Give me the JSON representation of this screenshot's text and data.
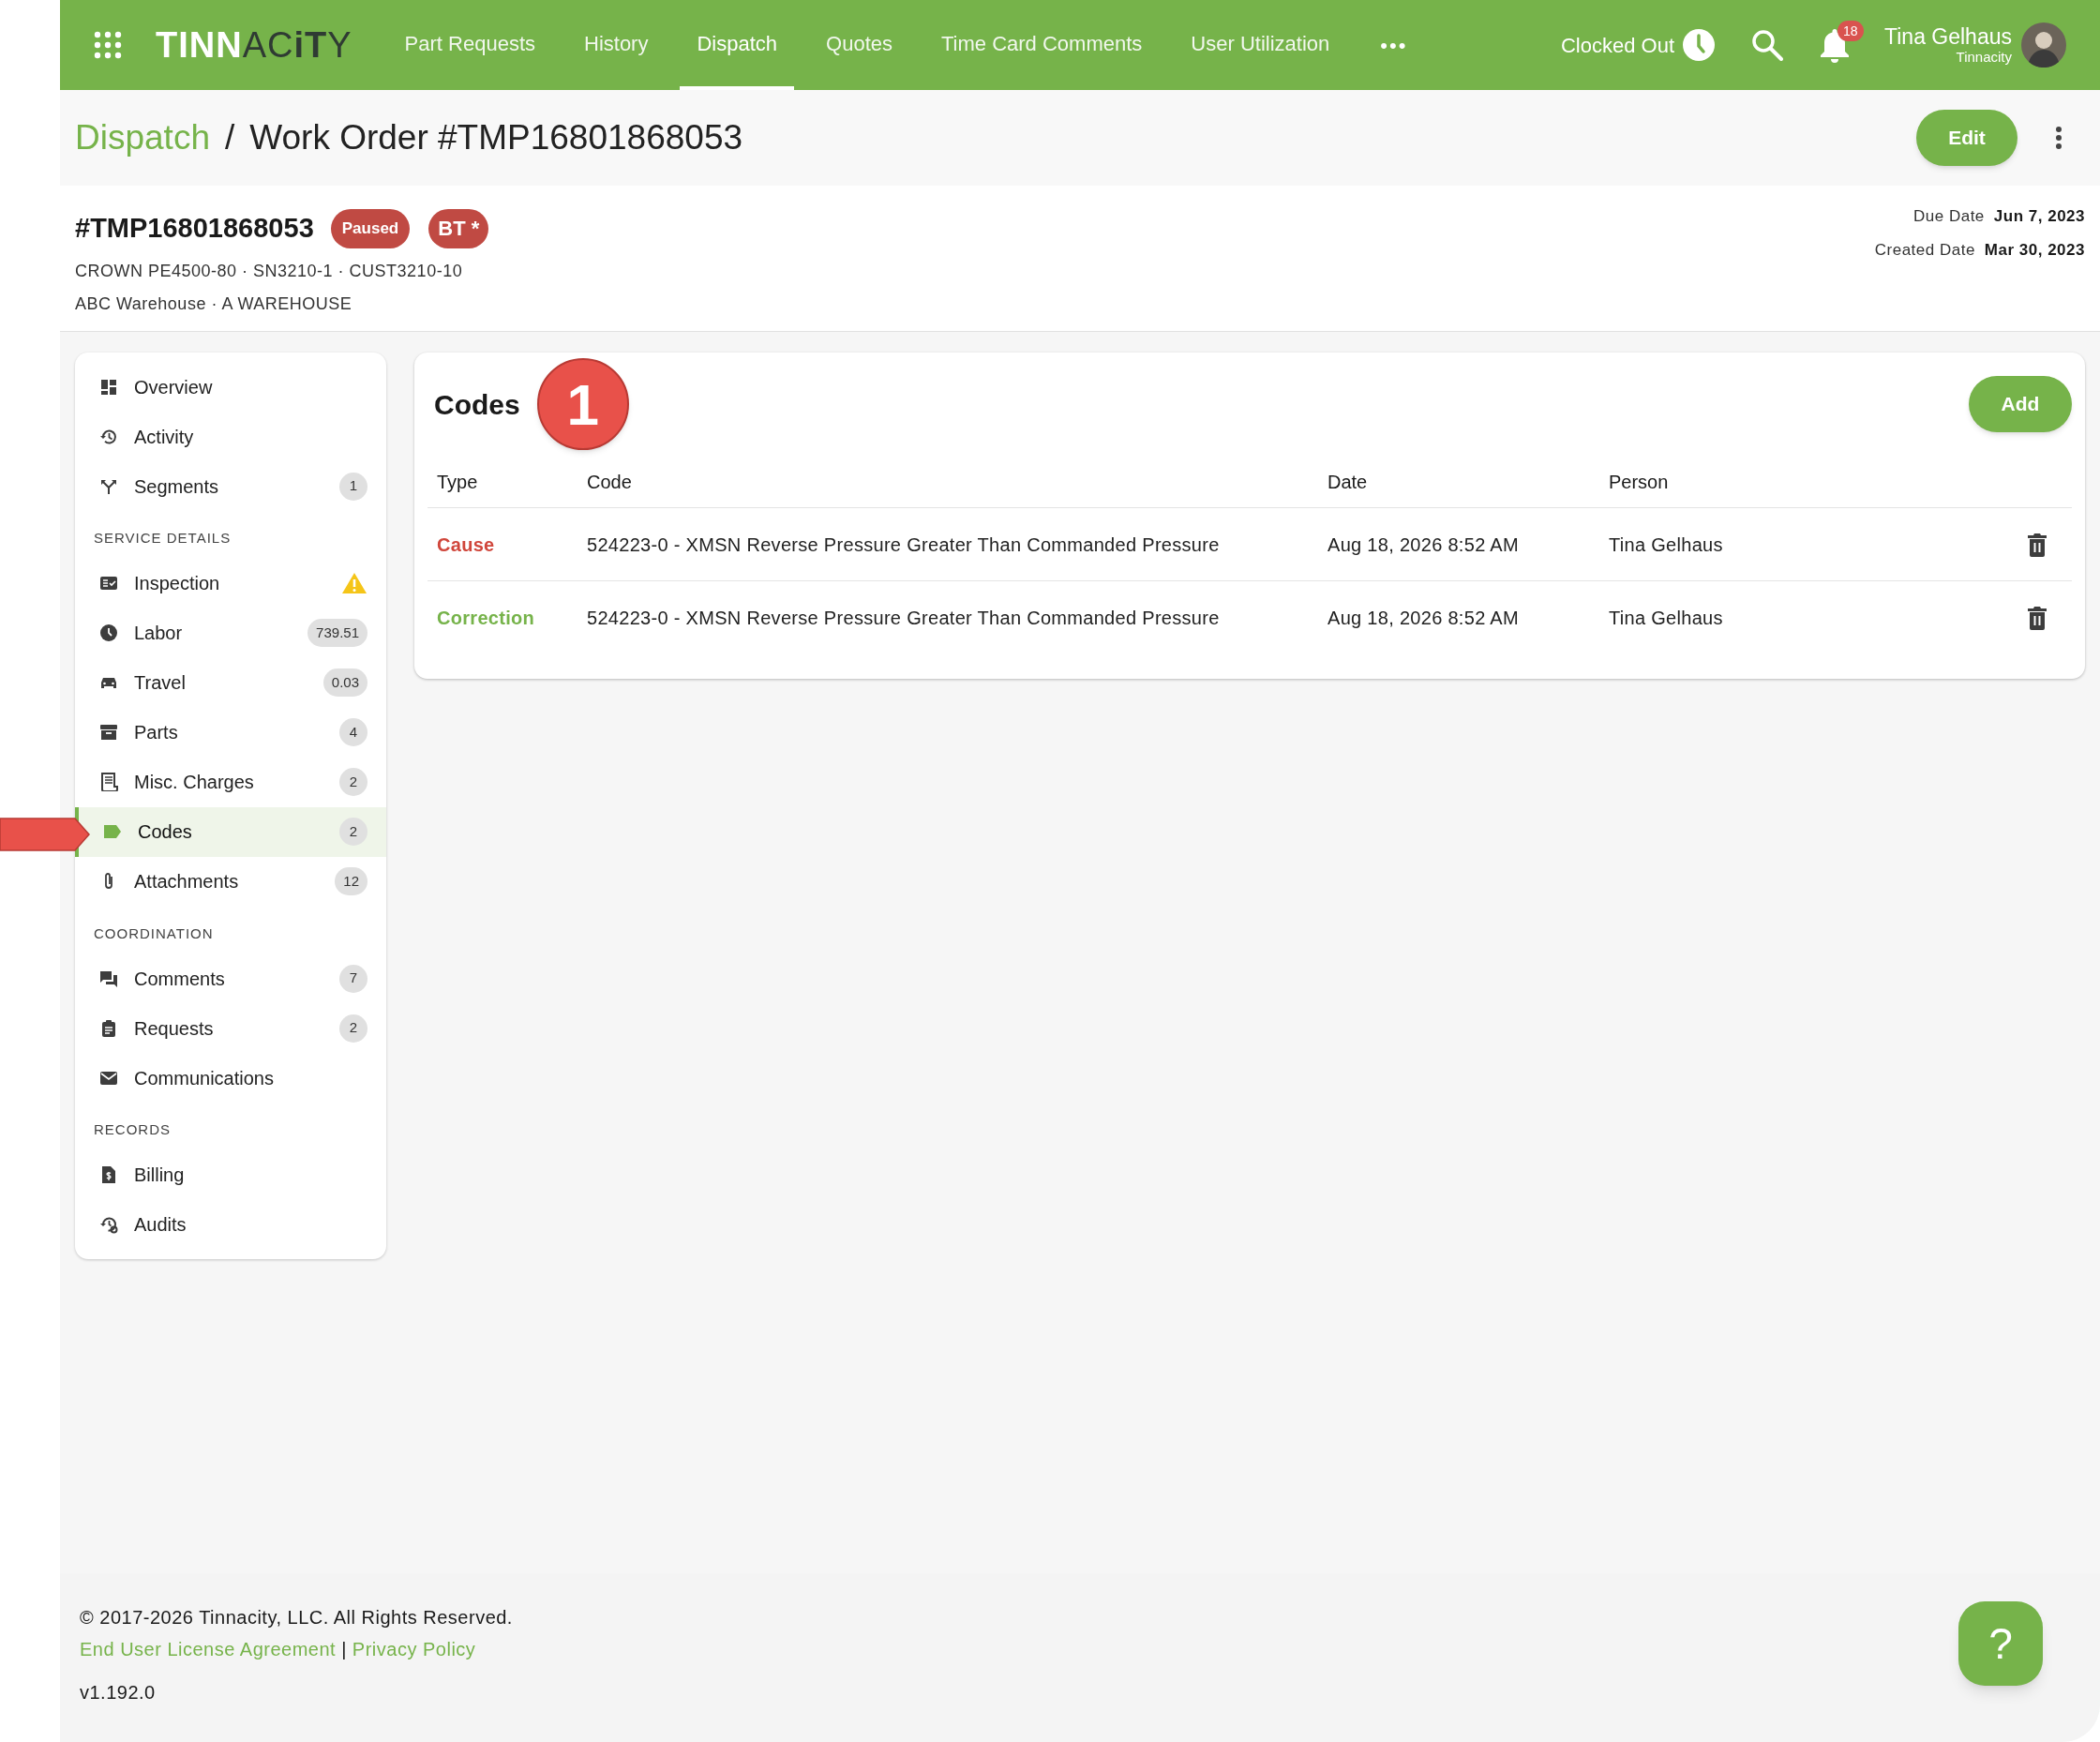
{
  "topbar": {
    "logo": [
      {
        "text": "TINN",
        "kind": "light"
      },
      {
        "text": "AC",
        "kind": "thin"
      },
      {
        "text": "iT",
        "kind": "dark"
      },
      {
        "text": "Y",
        "kind": "thin"
      }
    ],
    "nav": [
      {
        "label": "Part Requests",
        "selected": false
      },
      {
        "label": "History",
        "selected": false
      },
      {
        "label": "Dispatch",
        "selected": true
      },
      {
        "label": "Quotes",
        "selected": false
      },
      {
        "label": "Time Card Comments",
        "selected": false
      },
      {
        "label": "User Utilization",
        "selected": false
      }
    ],
    "more": "•••",
    "clock_status": "Clocked Out",
    "notification_count": "18",
    "user_name": "Tina Gelhaus",
    "user_org": "Tinnacity"
  },
  "breadcrumb": {
    "parent": "Dispatch",
    "separator": "/",
    "current": "Work Order #TMP16801868053"
  },
  "edit_button": "Edit",
  "work_order": {
    "number": "#TMP16801868053",
    "badges": [
      {
        "label": "Paused",
        "kind": "small"
      },
      {
        "label": "BT *",
        "kind": "large"
      }
    ],
    "equipment": "CROWN PE4500-80 · SN3210-1 · CUST3210-10",
    "location": "ABC Warehouse · A WAREHOUSE",
    "dates": [
      {
        "label": "Due Date",
        "value": "Jun 7, 2023"
      },
      {
        "label": "Created Date",
        "value": "Mar 30, 2023"
      }
    ]
  },
  "sidebar": {
    "sections": [
      {
        "items": [
          {
            "label": "Overview",
            "selected": false,
            "warning": false
          },
          {
            "label": "Activity",
            "selected": false,
            "warning": false
          },
          {
            "label": "Segments",
            "badge": "1",
            "selected": false,
            "warning": false
          }
        ]
      },
      {
        "heading": "SERVICE DETAILS",
        "items": [
          {
            "label": "Inspection",
            "selected": false,
            "warning": true
          },
          {
            "label": "Labor",
            "badge": "739.51",
            "selected": false,
            "warning": false
          },
          {
            "label": "Travel",
            "badge": "0.03",
            "selected": false,
            "warning": false
          },
          {
            "label": "Parts",
            "badge": "4",
            "selected": false,
            "warning": false
          },
          {
            "label": "Misc. Charges",
            "badge": "2",
            "selected": false,
            "warning": false
          },
          {
            "label": "Codes",
            "badge": "2",
            "selected": true,
            "warning": false
          },
          {
            "label": "Attachments",
            "badge": "12",
            "selected": false,
            "warning": false
          }
        ]
      },
      {
        "heading": "COORDINATION",
        "items": [
          {
            "label": "Comments",
            "badge": "7",
            "selected": false,
            "warning": false
          },
          {
            "label": "Requests",
            "badge": "2",
            "selected": false,
            "warning": false
          },
          {
            "label": "Communications",
            "selected": false,
            "warning": false
          }
        ]
      },
      {
        "heading": "RECORDS",
        "items": [
          {
            "label": "Billing",
            "selected": false,
            "warning": false
          },
          {
            "label": "Audits",
            "selected": false,
            "warning": false
          }
        ]
      }
    ]
  },
  "codes": {
    "title": "Codes",
    "step_number": "1",
    "add_button": "Add",
    "columns": [
      "Type",
      "Code",
      "Date",
      "Person"
    ],
    "rows": [
      {
        "type": "Cause",
        "color": "#d0463b",
        "code": "524223-0 - XMSN Reverse Pressure Greater Than Commanded Pressure",
        "date": "Aug 18, 2026 8:52 AM",
        "person": "Tina Gelhaus"
      },
      {
        "type": "Correction",
        "color": "#76b34a",
        "code": "524223-0 - XMSN Reverse Pressure Greater Than Commanded Pressure",
        "date": "Aug 18, 2026 8:52 AM",
        "person": "Tina Gelhaus"
      }
    ]
  },
  "footer": {
    "copyright": "© 2017-2026 Tinnacity, LLC. All Rights Reserved.",
    "links": [
      "End User License Agreement",
      "Privacy Policy"
    ],
    "link_separator": "|",
    "version": "v1.192.0",
    "help_button": "?"
  }
}
